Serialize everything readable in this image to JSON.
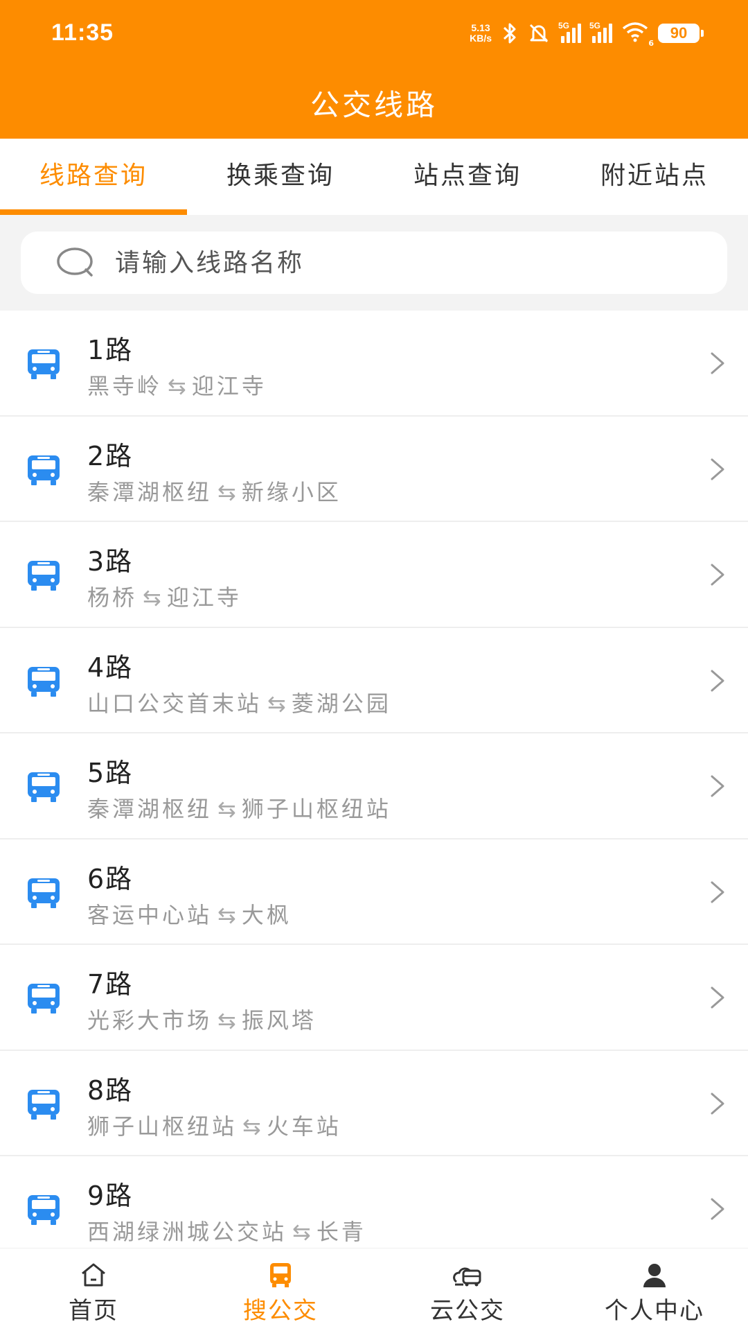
{
  "status_bar": {
    "time": "11:35",
    "net_speed_value": "5.13",
    "net_speed_unit": "KB/s",
    "signal1_label": "5G",
    "signal2_label": "5G",
    "wifi_sub": "6",
    "battery": "90"
  },
  "header": {
    "title": "公交线路"
  },
  "tabs": [
    {
      "label": "线路查询",
      "active": true
    },
    {
      "label": "换乘查询",
      "active": false
    },
    {
      "label": "站点查询",
      "active": false
    },
    {
      "label": "附近站点",
      "active": false
    }
  ],
  "search": {
    "placeholder": "请输入线路名称"
  },
  "swap_glyph": "⇆",
  "routes": [
    {
      "name": "1路",
      "from": "黑寺岭",
      "to": "迎江寺"
    },
    {
      "name": "2路",
      "from": "秦潭湖枢纽",
      "to": "新缘小区"
    },
    {
      "name": "3路",
      "from": "杨桥",
      "to": "迎江寺"
    },
    {
      "name": "4路",
      "from": "山口公交首末站",
      "to": "菱湖公园"
    },
    {
      "name": "5路",
      "from": "秦潭湖枢纽",
      "to": "狮子山枢纽站"
    },
    {
      "name": "6路",
      "from": "客运中心站",
      "to": "大枫"
    },
    {
      "name": "7路",
      "from": "光彩大市场",
      "to": "振风塔"
    },
    {
      "name": "8路",
      "from": "狮子山枢纽站",
      "to": "火车站"
    },
    {
      "name": "9路",
      "from": "西湖绿洲城公交站",
      "to": "长青"
    }
  ],
  "bottom_nav": [
    {
      "label": "首页",
      "icon": "home-icon"
    },
    {
      "label": "搜公交",
      "icon": "bus-icon",
      "active": true
    },
    {
      "label": "云公交",
      "icon": "cloud-bus-icon"
    },
    {
      "label": "个人中心",
      "icon": "user-icon"
    }
  ],
  "colors": {
    "accent": "#fd8c00",
    "bus_icon": "#2b8cf0",
    "muted_text": "#999999"
  }
}
